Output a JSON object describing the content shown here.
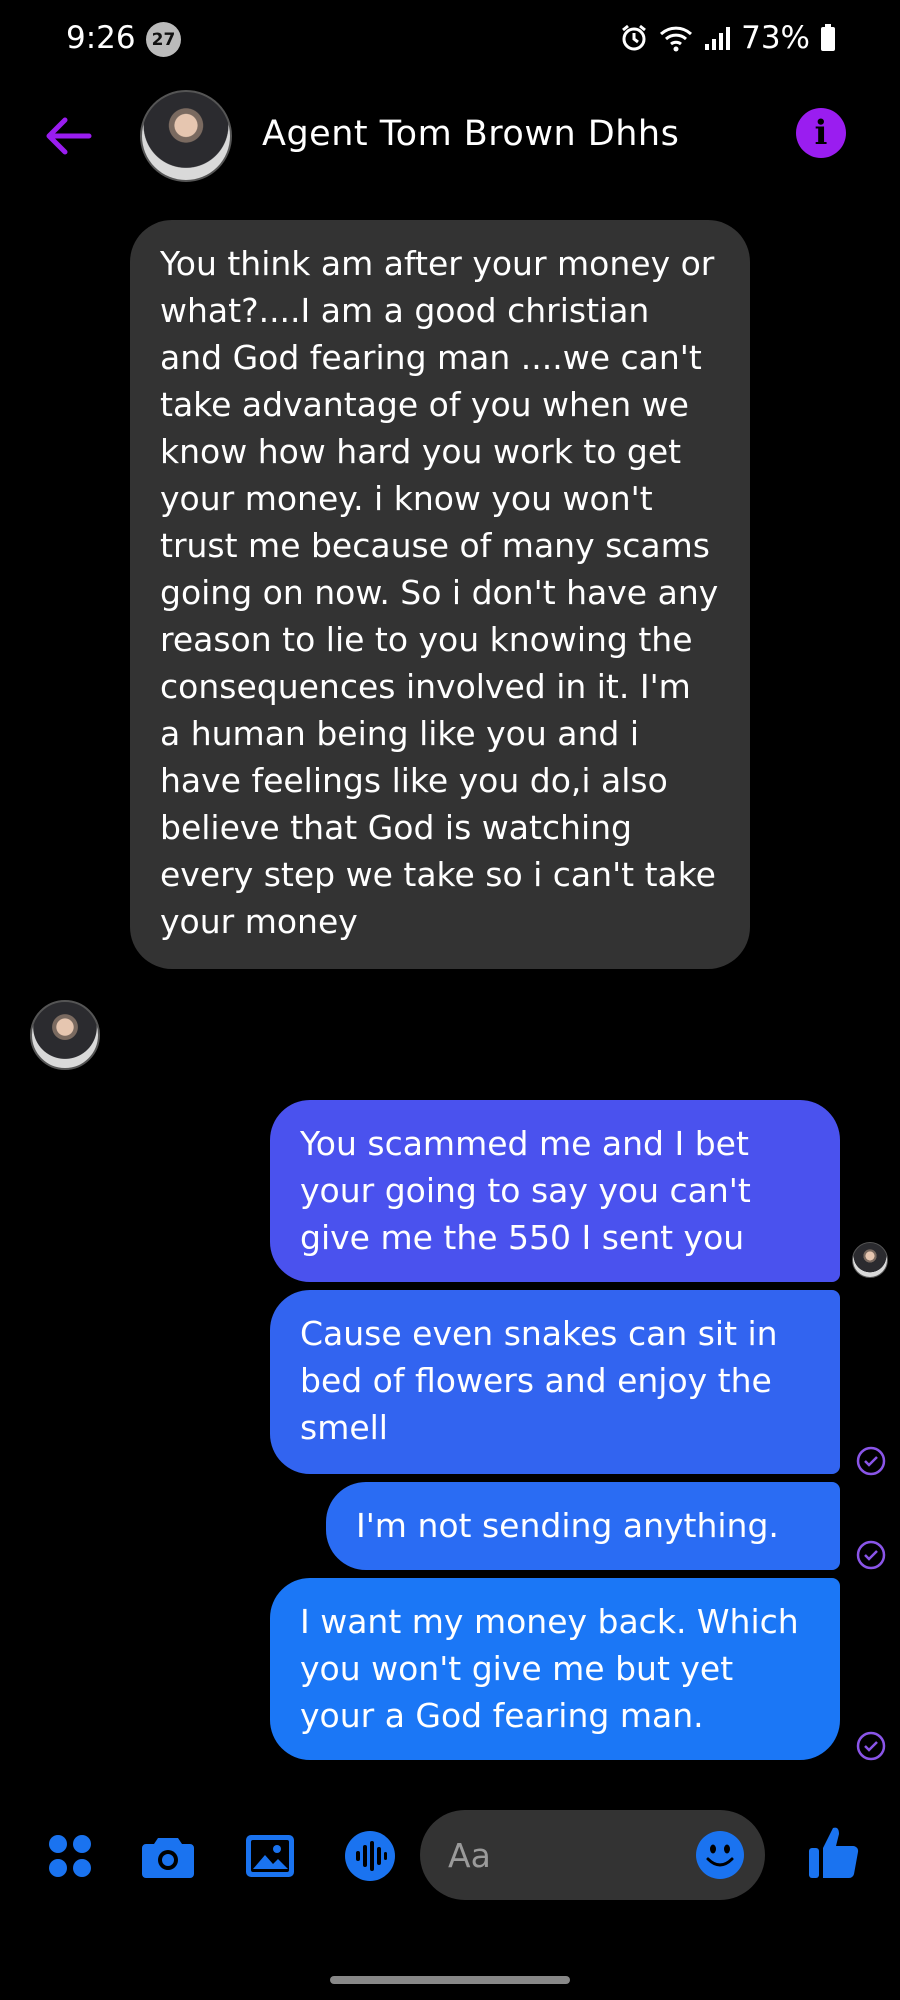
{
  "status_bar": {
    "time": "9:26",
    "notification_count": "27",
    "battery": "73%"
  },
  "header": {
    "contact_name": "Agent Tom Brown Dhhs",
    "info_label": "i"
  },
  "messages": {
    "incoming": [
      {
        "text": "You think am after your money or what?....I am a good christian and God fearing man ....we can't take advantage of you when we know how hard you work to get your money. i know you won't trust me because of many scams going on now. So i don't have any reason to lie to you knowing the consequences involved in it. I'm a human being like you and i have feelings like you do,i also believe that God is watching every step we take so i can't take your money"
      }
    ],
    "outgoing": [
      {
        "text": "You scammed me and I bet your going to say you can't give me the 550 I sent you"
      },
      {
        "text": "Cause even snakes can sit in bed of flowers and enjoy the smell"
      },
      {
        "text": "I'm not sending anything."
      },
      {
        "text": "I want my money back. Which you won't give me but yet your a God fearing man."
      }
    ]
  },
  "composer": {
    "placeholder": "Aa",
    "icons": [
      "menu-icon",
      "camera-icon",
      "gallery-icon",
      "microphone-icon",
      "emoji-icon",
      "thumbs-up-icon"
    ]
  },
  "colors": {
    "accent": "#9a1df0",
    "icon_blue": "#1a73f0",
    "incoming_bubble": "#333333",
    "outgoing_gradient": [
      "#4a52ee",
      "#3264f0",
      "#2a6cf3",
      "#1b77f6"
    ]
  }
}
